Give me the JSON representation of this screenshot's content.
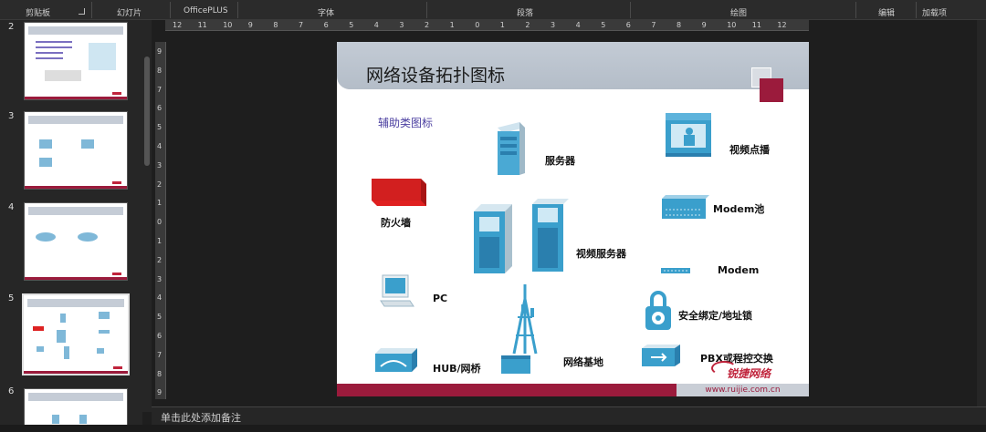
{
  "ribbon": {
    "groups": [
      "剪贴板",
      "幻灯片",
      "OfficePLUS",
      "字体",
      "段落",
      "绘图",
      "编辑",
      "加载项"
    ]
  },
  "thumbnails": {
    "numbers": [
      "2",
      "3",
      "4",
      "5",
      "6"
    ],
    "active_index": 3
  },
  "ruler": {
    "horizontal": [
      "12",
      "11",
      "10",
      "9",
      "8",
      "7",
      "6",
      "5",
      "4",
      "3",
      "2",
      "1",
      "0",
      "1",
      "2",
      "3",
      "4",
      "5",
      "6",
      "7",
      "8",
      "9",
      "10",
      "11",
      "12"
    ],
    "vertical": [
      "9",
      "8",
      "7",
      "6",
      "5",
      "4",
      "3",
      "2",
      "1",
      "0",
      "1",
      "2",
      "3",
      "4",
      "5",
      "6",
      "7",
      "8",
      "9"
    ]
  },
  "slide": {
    "title": "网络设备拓扑图标",
    "aux_label": "辅助类图标",
    "labels": {
      "server": "服务器",
      "video_on_demand": "视频点播",
      "firewall": "防火墙",
      "modem_pool": "Modem池",
      "video_server": "视频服务器",
      "modem": "Modem",
      "pc": "PC",
      "security": "安全绑定/地址锁",
      "hub": "HUB/网桥",
      "base_station": "网络基地",
      "pbx": "PBX或程控交换"
    },
    "logo": "锐捷网络",
    "url": "www.ruijie.com.cn"
  },
  "notes": {
    "placeholder": "单击此处添加备注"
  },
  "colors": {
    "accent": "#9b1b3c",
    "icon_blue": "#3a9fcc",
    "firewall_red": "#d21f1f"
  }
}
